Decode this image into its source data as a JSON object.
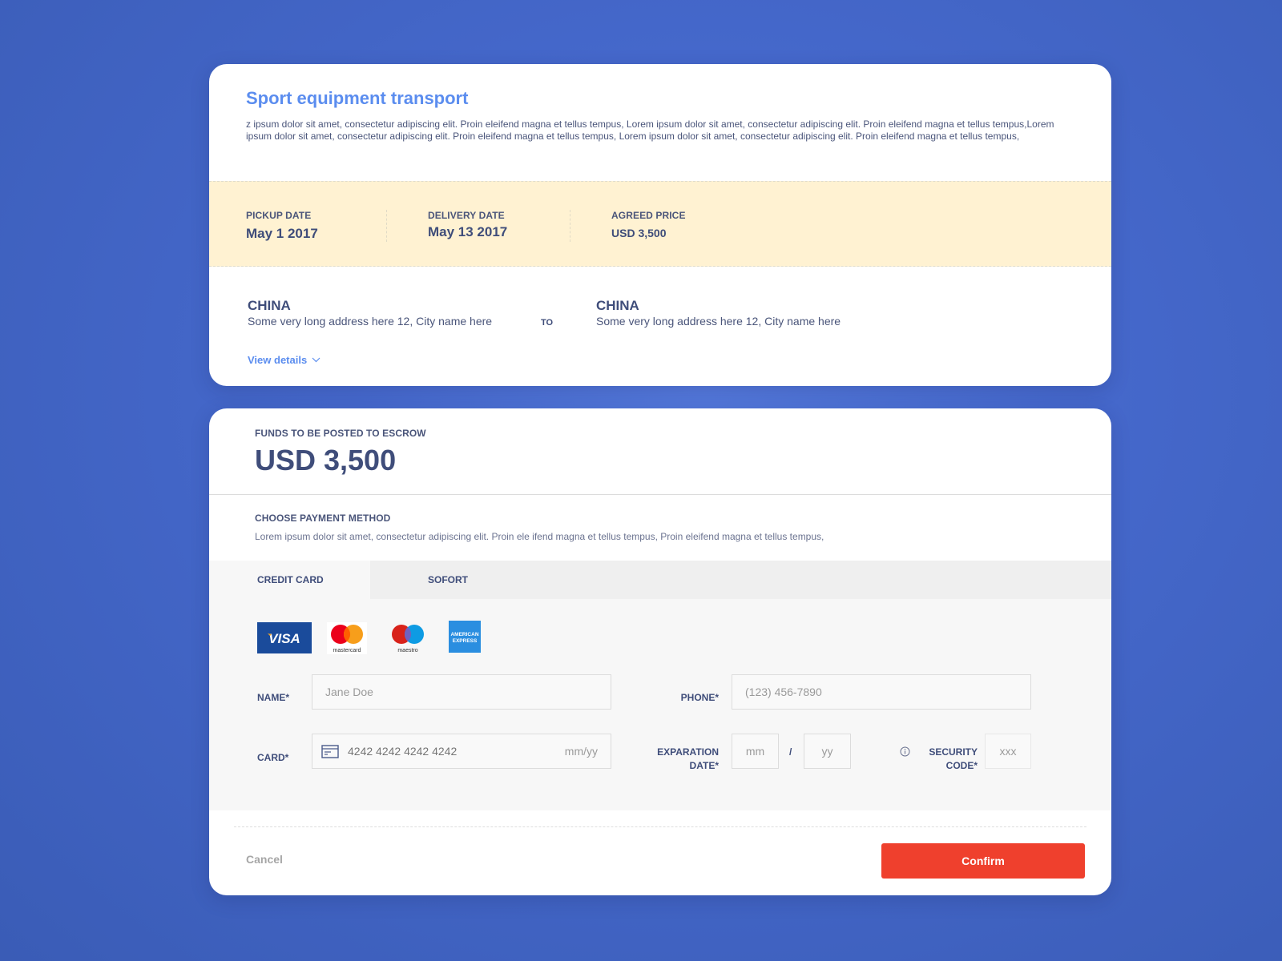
{
  "shipment": {
    "title": "Sport equipment transport",
    "description": "z ipsum dolor sit amet, consectetur adipiscing elit. Proin eleifend magna et tellus tempus, Lorem ipsum dolor sit amet, consectetur adipiscing elit. Proin eleifend magna et tellus tempus,Lorem ipsum dolor sit amet, consectetur adipiscing elit. Proin eleifend magna et tellus tempus, Lorem ipsum dolor sit amet, consectetur adipiscing elit. Proin eleifend magna et tellus tempus,",
    "pickup": {
      "label": "PICKUP DATE",
      "value": "May 1 2017"
    },
    "delivery": {
      "label": "DELIVERY DATE",
      "value": "May 13 2017"
    },
    "price": {
      "label": "AGREED PRICE",
      "value": "USD 3,500"
    },
    "origin": {
      "country": "CHINA",
      "address": "Some very long address here 12, City name here"
    },
    "to_label": "TO",
    "destination": {
      "country": "CHINA",
      "address": "Some very long address here 12, City name here"
    },
    "view_details": "View details"
  },
  "payment": {
    "funds_label": "FUNDS TO BE POSTED TO ESCROW",
    "funds_amount": "USD 3,500",
    "method_title": "CHOOSE PAYMENT METHOD",
    "method_desc": "Lorem ipsum dolor sit amet, consectetur adipiscing elit. Proin ele ifend magna et tellus tempus, Proin eleifend magna et tellus tempus,",
    "tabs": [
      {
        "label": "CREDIT CARD",
        "active": true
      },
      {
        "label": "SOFORT",
        "active": false
      }
    ],
    "card_brands": [
      "visa",
      "mastercard",
      "maestro",
      "american-express"
    ],
    "brand_text": {
      "visa": "VISA",
      "mastercard": "mastercard",
      "maestro": "maestro",
      "amex_line1": "AMERICAN",
      "amex_line2": "EXPRESS"
    },
    "form": {
      "name_label": "NAME*",
      "name_placeholder": "Jane Doe",
      "phone_label": "PHONE*",
      "phone_placeholder": "(123) 456-7890",
      "card_label": "CARD*",
      "card_placeholder": "4242 4242 4242 4242",
      "card_expiry_hint": "mm/yy",
      "expiry_label_1": "EXPARATION",
      "expiry_label_2": "DATE*",
      "mm_placeholder": "mm",
      "slash": "/",
      "yy_placeholder": "yy",
      "security_label_1": "SECURITY",
      "security_label_2": "CODE*",
      "security_placeholder": "xxx"
    },
    "cancel_label": "Cancel",
    "confirm_label": "Confirm"
  },
  "colors": {
    "accent": "#5b8def",
    "confirm": "#ef402d",
    "band": "#fff2d2",
    "text": "#3f4d7a"
  }
}
